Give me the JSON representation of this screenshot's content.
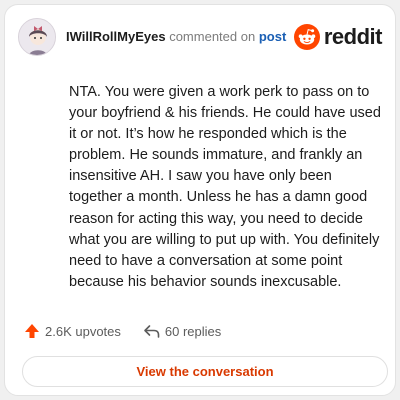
{
  "header": {
    "username": "IWillRollMyEyes",
    "commented_text": "commented on",
    "post_link": "post",
    "brand": "reddit"
  },
  "comment": {
    "body": "NTA. You were given a work perk to pass on to your boyfriend & his friends. He could have used it or not. It’s how he responded which is the problem. He sounds immature, and frankly an insensitive AH. I saw you have only been together a month. Unless he has a damn good reason for acting this way, you need to decide what you are willing to put up with. You definitely need to have a conversation at some point because his behavior sounds inexcusable."
  },
  "footer": {
    "upvotes": "2.6K upvotes",
    "replies": "60 replies",
    "upvote_icon": "upvote-arrow-icon",
    "reply_icon": "reply-arrow-icon"
  },
  "cta": {
    "label": "View the conversation"
  },
  "colors": {
    "brand_orange": "#ff4500",
    "cta_text": "#d93900",
    "link_blue": "#1a5fb4"
  }
}
